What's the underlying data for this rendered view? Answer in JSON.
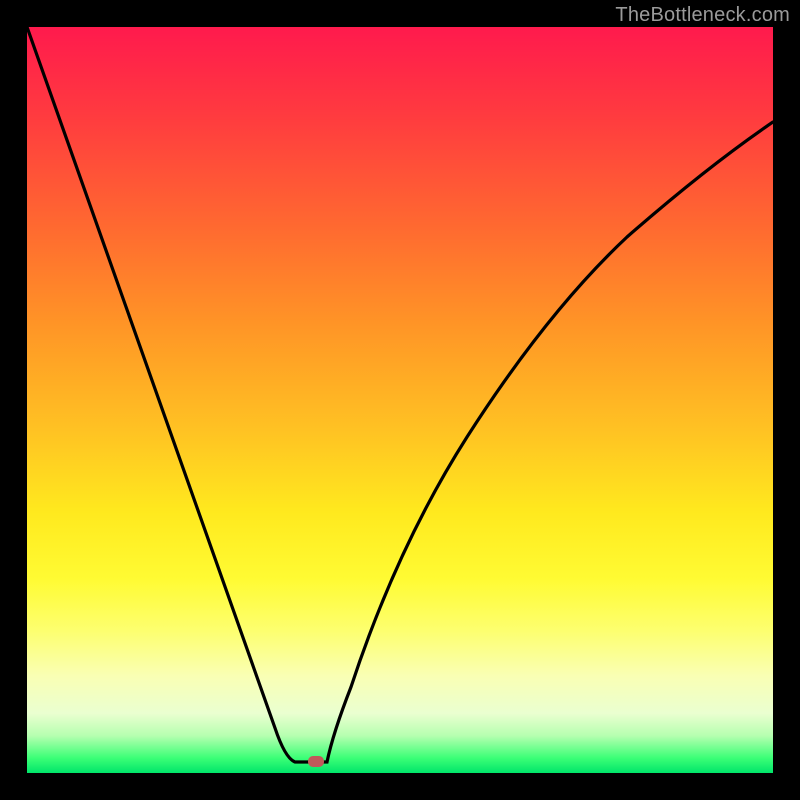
{
  "attribution": "TheBottleneck.com",
  "chart_data": {
    "type": "line",
    "title": "",
    "xlabel": "",
    "ylabel": "",
    "ylim": [
      0,
      100
    ],
    "xlim": [
      0,
      100
    ],
    "x": [
      0,
      5,
      10,
      15,
      20,
      25,
      30,
      33,
      36,
      38,
      40,
      42,
      45,
      50,
      55,
      60,
      65,
      70,
      75,
      80,
      85,
      90,
      95,
      100
    ],
    "values": [
      100,
      85,
      70,
      55,
      41,
      27,
      13,
      4,
      0,
      0,
      1,
      6,
      16,
      31,
      43,
      53,
      61,
      68,
      73,
      78,
      82,
      85,
      87,
      89
    ],
    "marker": {
      "x": 38.7,
      "y": 0,
      "color": "#c15a5a"
    },
    "gradient_stops": [
      {
        "pct": 0,
        "color": "#ff1a4d"
      },
      {
        "pct": 12,
        "color": "#ff3b3f"
      },
      {
        "pct": 27,
        "color": "#ff6a30"
      },
      {
        "pct": 40,
        "color": "#ff9526"
      },
      {
        "pct": 54,
        "color": "#ffc223"
      },
      {
        "pct": 65,
        "color": "#ffe91e"
      },
      {
        "pct": 74,
        "color": "#fffb33"
      },
      {
        "pct": 81,
        "color": "#fdff70"
      },
      {
        "pct": 87,
        "color": "#f9ffb4"
      },
      {
        "pct": 92,
        "color": "#eaffd0"
      },
      {
        "pct": 95,
        "color": "#b6ffb0"
      },
      {
        "pct": 98,
        "color": "#3bff76"
      },
      {
        "pct": 100,
        "color": "#00e56a"
      }
    ]
  }
}
